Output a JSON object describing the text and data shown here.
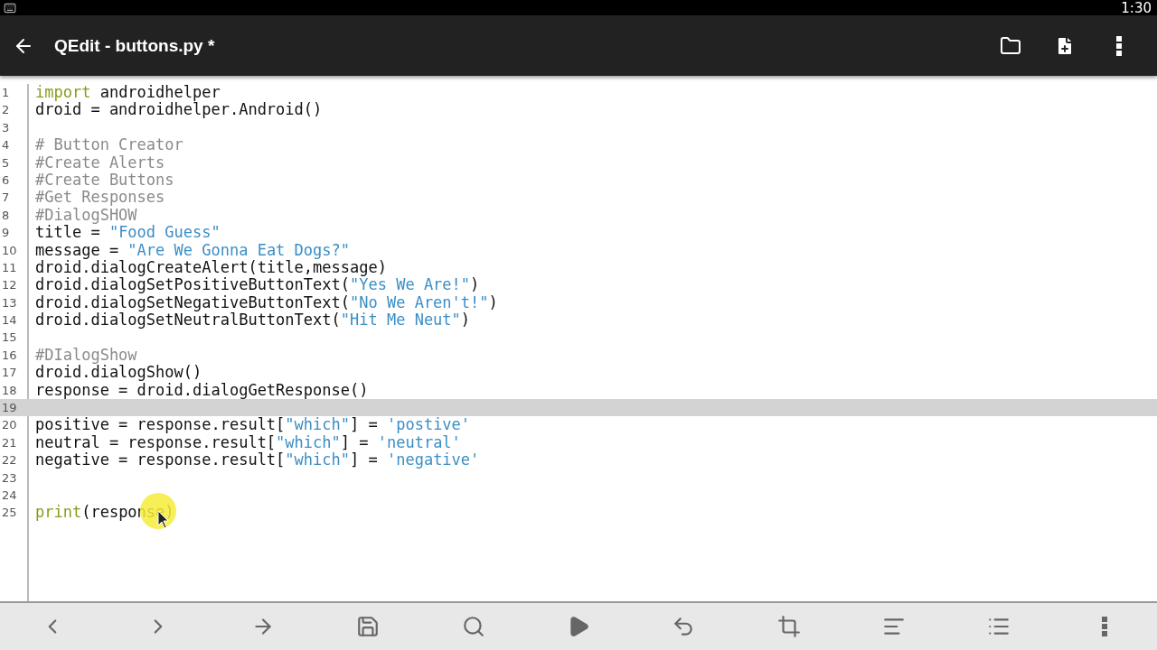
{
  "status_bar": {
    "time": "1:30"
  },
  "app_bar": {
    "title": "QEdit - buttons.py *"
  },
  "editor": {
    "lines": [
      {
        "number": "1",
        "current": false,
        "tokens": [
          {
            "kind": "keyword",
            "text": "import"
          },
          {
            "kind": "plain",
            "text": " androidhelper"
          }
        ]
      },
      {
        "number": "2",
        "current": false,
        "tokens": [
          {
            "kind": "plain",
            "text": "droid = androidhelper.Android()"
          }
        ]
      },
      {
        "number": "3",
        "current": false
      },
      {
        "number": "4",
        "current": false,
        "tokens": [
          {
            "kind": "comment",
            "text": "# Button Creator"
          }
        ]
      },
      {
        "number": "5",
        "current": false,
        "tokens": [
          {
            "kind": "comment",
            "text": "#Create Alerts"
          }
        ]
      },
      {
        "number": "6",
        "current": false,
        "tokens": [
          {
            "kind": "comment",
            "text": "#Create Buttons"
          }
        ]
      },
      {
        "number": "7",
        "current": false,
        "tokens": [
          {
            "kind": "comment",
            "text": "#Get Responses"
          }
        ]
      },
      {
        "number": "8",
        "current": false,
        "tokens": [
          {
            "kind": "comment",
            "text": "#DialogSHOW"
          }
        ]
      },
      {
        "number": "9",
        "current": false,
        "tokens": [
          {
            "kind": "plain",
            "text": "title = "
          },
          {
            "kind": "string",
            "text": "\"Food Guess\""
          }
        ]
      },
      {
        "number": "10",
        "current": false,
        "tokens": [
          {
            "kind": "plain",
            "text": "message = "
          },
          {
            "kind": "string",
            "text": "\"Are We Gonna Eat Dogs?\""
          }
        ]
      },
      {
        "number": "11",
        "current": false,
        "tokens": [
          {
            "kind": "plain",
            "text": "droid.dialogCreateAlert(title,message)"
          }
        ]
      },
      {
        "number": "12",
        "current": false,
        "tokens": [
          {
            "kind": "plain",
            "text": "droid.dialogSetPositiveButtonText("
          },
          {
            "kind": "string",
            "text": "\"Yes We Are!\""
          },
          {
            "kind": "plain",
            "text": ")"
          }
        ]
      },
      {
        "number": "13",
        "current": false,
        "tokens": [
          {
            "kind": "plain",
            "text": "droid.dialogSetNegativeButtonText("
          },
          {
            "kind": "string",
            "text": "\"No We Aren't!\""
          },
          {
            "kind": "plain",
            "text": ")"
          }
        ]
      },
      {
        "number": "14",
        "current": false,
        "tokens": [
          {
            "kind": "plain",
            "text": "droid.dialogSetNeutralButtonText("
          },
          {
            "kind": "string",
            "text": "\"Hit Me Neut\""
          },
          {
            "kind": "plain",
            "text": ")"
          }
        ]
      },
      {
        "number": "15",
        "current": false
      },
      {
        "number": "16",
        "current": false,
        "tokens": [
          {
            "kind": "comment",
            "text": "#DIalogShow"
          }
        ]
      },
      {
        "number": "17",
        "current": false,
        "tokens": [
          {
            "kind": "plain",
            "text": "droid.dialogShow()"
          }
        ]
      },
      {
        "number": "18",
        "current": false,
        "tokens": [
          {
            "kind": "plain",
            "text": "response = droid.dialogGetResponse()"
          }
        ]
      },
      {
        "number": "19",
        "current": true
      },
      {
        "number": "20",
        "current": false,
        "tokens": [
          {
            "kind": "plain",
            "text": "positive = response.result["
          },
          {
            "kind": "string",
            "text": "\"which\""
          },
          {
            "kind": "plain",
            "text": "] = "
          },
          {
            "kind": "string",
            "text": "'postive'"
          }
        ]
      },
      {
        "number": "21",
        "current": false,
        "tokens": [
          {
            "kind": "plain",
            "text": "neutral = response.result["
          },
          {
            "kind": "string",
            "text": "\"which\""
          },
          {
            "kind": "plain",
            "text": "] = "
          },
          {
            "kind": "string",
            "text": "'neutral'"
          }
        ]
      },
      {
        "number": "22",
        "current": false,
        "tokens": [
          {
            "kind": "plain",
            "text": "negative = response.result["
          },
          {
            "kind": "string",
            "text": "\"which\""
          },
          {
            "kind": "plain",
            "text": "] = "
          },
          {
            "kind": "string",
            "text": "'negative'"
          }
        ]
      },
      {
        "number": "23",
        "current": false
      },
      {
        "number": "24",
        "current": false
      },
      {
        "number": "25",
        "current": false,
        "tokens": [
          {
            "kind": "keyword",
            "text": "print"
          },
          {
            "kind": "plain",
            "text": "(response)"
          }
        ]
      }
    ]
  }
}
